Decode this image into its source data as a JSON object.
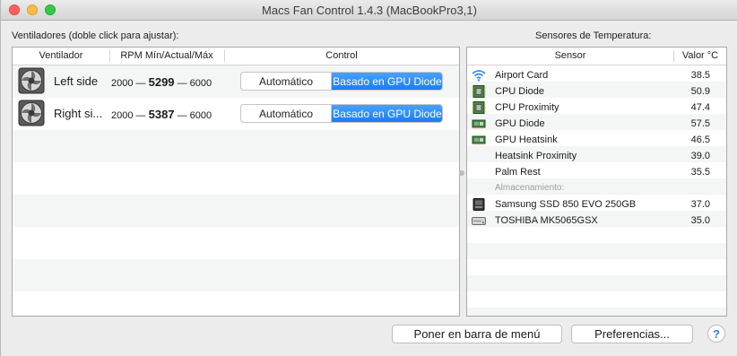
{
  "window": {
    "title": "Macs Fan Control 1.4.3 (MacBookPro3,1)"
  },
  "fans_section": {
    "label": "Ventiladores (doble click para ajustar):",
    "headers": {
      "fan": "Ventilador",
      "rpm": "RPM Mín/Actual/Máx",
      "control": "Control"
    },
    "rows": [
      {
        "name": "Left side",
        "min": "2000",
        "dash1": "—",
        "current": "5299",
        "dash2": "—",
        "max": "6000",
        "auto_label": "Automático",
        "mode_label": "Basado en GPU Diode",
        "icon": "fan-icon"
      },
      {
        "name": "Right si...",
        "min": "2000",
        "dash1": "—",
        "current": "5387",
        "dash2": "—",
        "max": "6000",
        "auto_label": "Automático",
        "mode_label": "Basado en GPU Diode",
        "icon": "fan-icon"
      }
    ]
  },
  "sensors_section": {
    "label": "Sensores de Temperatura:",
    "headers": {
      "sensor": "Sensor",
      "value": "Valor °C"
    },
    "rows": [
      {
        "name": "Airport Card",
        "value": "38.5",
        "icon": "wifi-icon"
      },
      {
        "name": "CPU Diode",
        "value": "50.9",
        "icon": "chip-icon"
      },
      {
        "name": "CPU Proximity",
        "value": "47.4",
        "icon": "chip-icon"
      },
      {
        "name": "GPU Diode",
        "value": "57.5",
        "icon": "gpu-card-icon"
      },
      {
        "name": "GPU Heatsink",
        "value": "46.5",
        "icon": "gpu-card-icon"
      },
      {
        "name": "Heatsink Proximity",
        "value": "39.0",
        "icon": ""
      },
      {
        "name": "Palm Rest",
        "value": "35.5",
        "icon": ""
      }
    ],
    "storage_group_label": "Almacenamiento:",
    "storage_rows": [
      {
        "name": "Samsung SSD 850 EVO 250GB",
        "value": "37.0",
        "icon": "ssd-icon"
      },
      {
        "name": "TOSHIBA MK5065GSX",
        "value": "35.0",
        "icon": "hdd-icon"
      }
    ]
  },
  "footer": {
    "menu_bar_button": "Poner en barra de menú",
    "prefs_button": "Preferencias...",
    "help_button": "?"
  },
  "colors": {
    "accent": "#1b7cf4",
    "stripe": "#f4f5f5",
    "wifi": "#2f8df5",
    "chip": "#3e8c3a"
  }
}
